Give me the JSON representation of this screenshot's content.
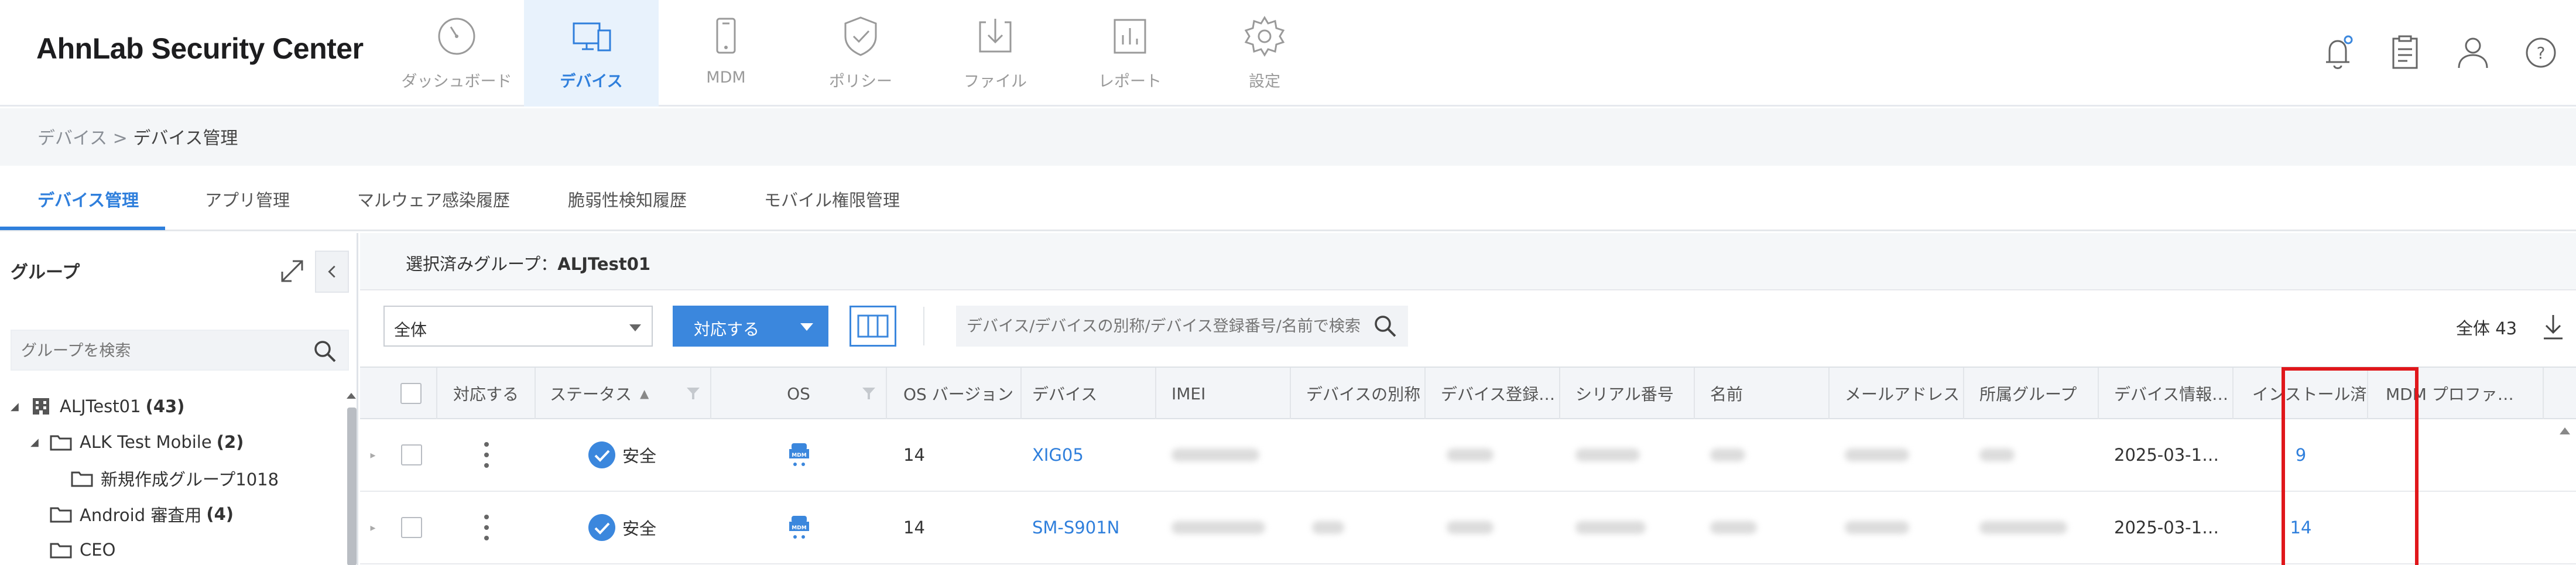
{
  "header": {
    "logo": "AhnLab Security Center",
    "nav": [
      {
        "label": "ダッシュボード",
        "icon": "dashboard-gauge-icon",
        "active": false
      },
      {
        "label": "デバイス",
        "icon": "devices-icon",
        "active": true
      },
      {
        "label": "MDM",
        "icon": "mobile-phone-icon",
        "active": false
      },
      {
        "label": "ポリシー",
        "icon": "shield-check-icon",
        "active": false
      },
      {
        "label": "ファイル",
        "icon": "file-download-icon",
        "active": false
      },
      {
        "label": "レポート",
        "icon": "report-chart-icon",
        "active": false
      },
      {
        "label": "設定",
        "icon": "gear-icon",
        "active": false
      }
    ],
    "right_icons": [
      "notification-bell-icon",
      "clipboard-icon",
      "user-icon",
      "help-icon"
    ]
  },
  "breadcrumb": {
    "parent": "デバイス",
    "separator": " > ",
    "current": "デバイス管理"
  },
  "subtabs": [
    "デバイス管理",
    "アプリ管理",
    "マルウェア感染履歴",
    "脆弱性検知履歴",
    "モバイル権限管理"
  ],
  "group_panel": {
    "title": "グループ",
    "search_placeholder": "グループを検索",
    "tree": [
      {
        "name": "ALJTest01",
        "count": "(43)"
      },
      {
        "name": "ALK Test Mobile",
        "count": "(2)"
      },
      {
        "name": "新規作成グループ1018",
        "count": ""
      },
      {
        "name": "Android 審査用",
        "count": "(4)"
      },
      {
        "name": "CEO",
        "count": ""
      }
    ]
  },
  "main": {
    "selected_group_label": "選択済みグループ：",
    "selected_group": "ALJTest01",
    "filter_value": "全体",
    "action_button": "対応する",
    "search_placeholder": "デバイス/デバイスの別称/デバイス登録番号/名前で検索",
    "total": "全体 43"
  },
  "table": {
    "columns": [
      "対応する",
      "ステータス",
      "OS",
      "OS バージョン",
      "デバイス",
      "IMEI",
      "デバイスの別称",
      "デバイス登録…",
      "シリアル番号",
      "名前",
      "メールアドレス",
      "所属グループ",
      "デバイス情報…",
      "インストール済…",
      "MDM プロファ…"
    ],
    "rows": [
      {
        "status": "安全",
        "os_icon": "android-mdm-icon",
        "os_version": "14",
        "device": "XIG05",
        "device_info": "2025-03-1…",
        "installed": "9"
      },
      {
        "status": "安全",
        "os_icon": "android-mdm-icon",
        "os_version": "14",
        "device": "SM-S901N",
        "device_info": "2025-03-1…",
        "installed": "14"
      }
    ]
  },
  "colors": {
    "accent": "#2f7fdc",
    "nav_active_bg": "#e8f2fc",
    "highlight": "#e0171b",
    "safe": "#3b87dd"
  }
}
